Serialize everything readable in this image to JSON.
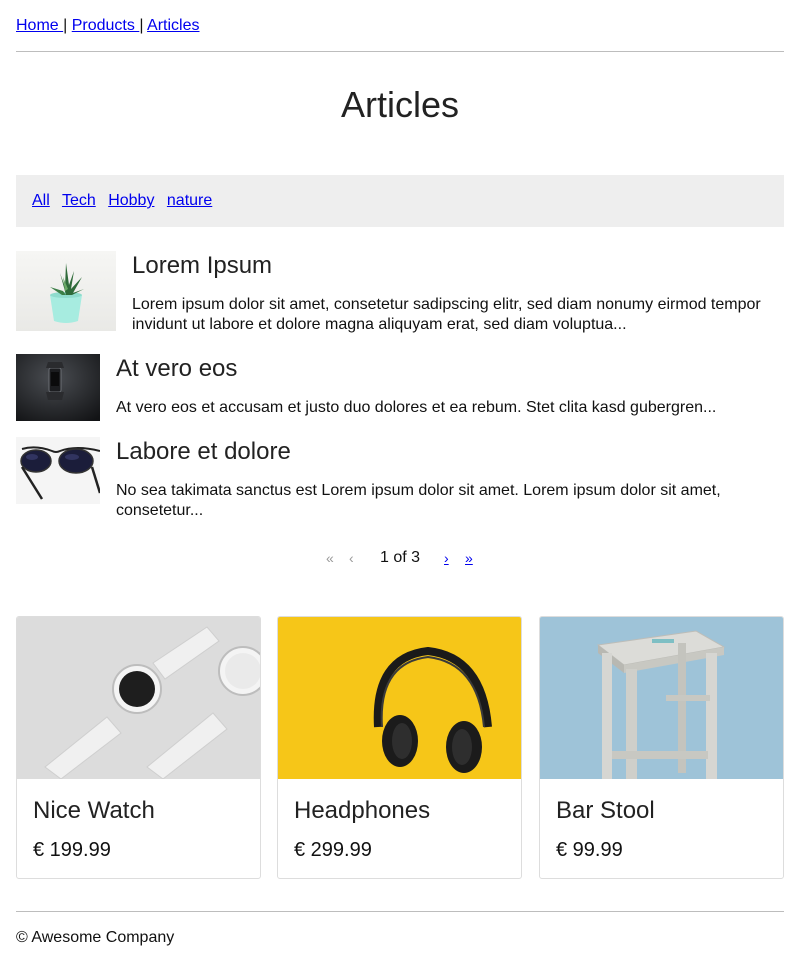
{
  "nav": {
    "items": [
      {
        "label": "Home "
      },
      {
        "label": "Products "
      },
      {
        "label": "Articles"
      }
    ],
    "separator": "|"
  },
  "page_title": "Articles",
  "filters": {
    "items": [
      {
        "label": "All"
      },
      {
        "label": "Tech"
      },
      {
        "label": "Hobby"
      },
      {
        "label": "nature"
      }
    ]
  },
  "articles": [
    {
      "title": "Lorem Ipsum",
      "excerpt": "Lorem ipsum dolor sit amet, consetetur sadipscing elitr, sed diam nonumy eirmod tempor invidunt ut labore et dolore magna aliquyam erat, sed diam voluptua...",
      "image": "succulent-plant-in-pot"
    },
    {
      "title": "At vero eos",
      "excerpt": "At vero eos et accusam et justo duo dolores et ea rebum. Stet clita kasd gubergren...",
      "image": "watch-on-dark-surface"
    },
    {
      "title": "Labore et dolore",
      "excerpt": "No sea takimata sanctus est Lorem ipsum dolor sit amet. Lorem ipsum dolor sit amet, consetetur...",
      "image": "sunglasses"
    }
  ],
  "pager": {
    "first_icon": "double-chevron-left-icon",
    "prev_icon": "chevron-left-icon",
    "label": "1 of 3",
    "next_icon": "chevron-right-icon",
    "last_icon": "double-chevron-right-icon",
    "first_glyph": "«",
    "prev_glyph": "‹",
    "next_glyph": "›",
    "last_glyph": "»"
  },
  "products": [
    {
      "name": "Nice Watch",
      "price": "€ 199.99",
      "image": "white-smartwatches"
    },
    {
      "name": "Headphones",
      "price": "€ 299.99",
      "image": "black-headphones-on-yellow"
    },
    {
      "name": "Bar Stool",
      "price": "€ 99.99",
      "image": "wooden-bar-stool-on-blue"
    }
  ],
  "footer": {
    "copyright": "© Awesome Company"
  },
  "colors": {
    "link": "#0000ee",
    "filter_bg": "#eeeeee",
    "divider": "#bdbdbd",
    "card_border": "#dddddd"
  }
}
